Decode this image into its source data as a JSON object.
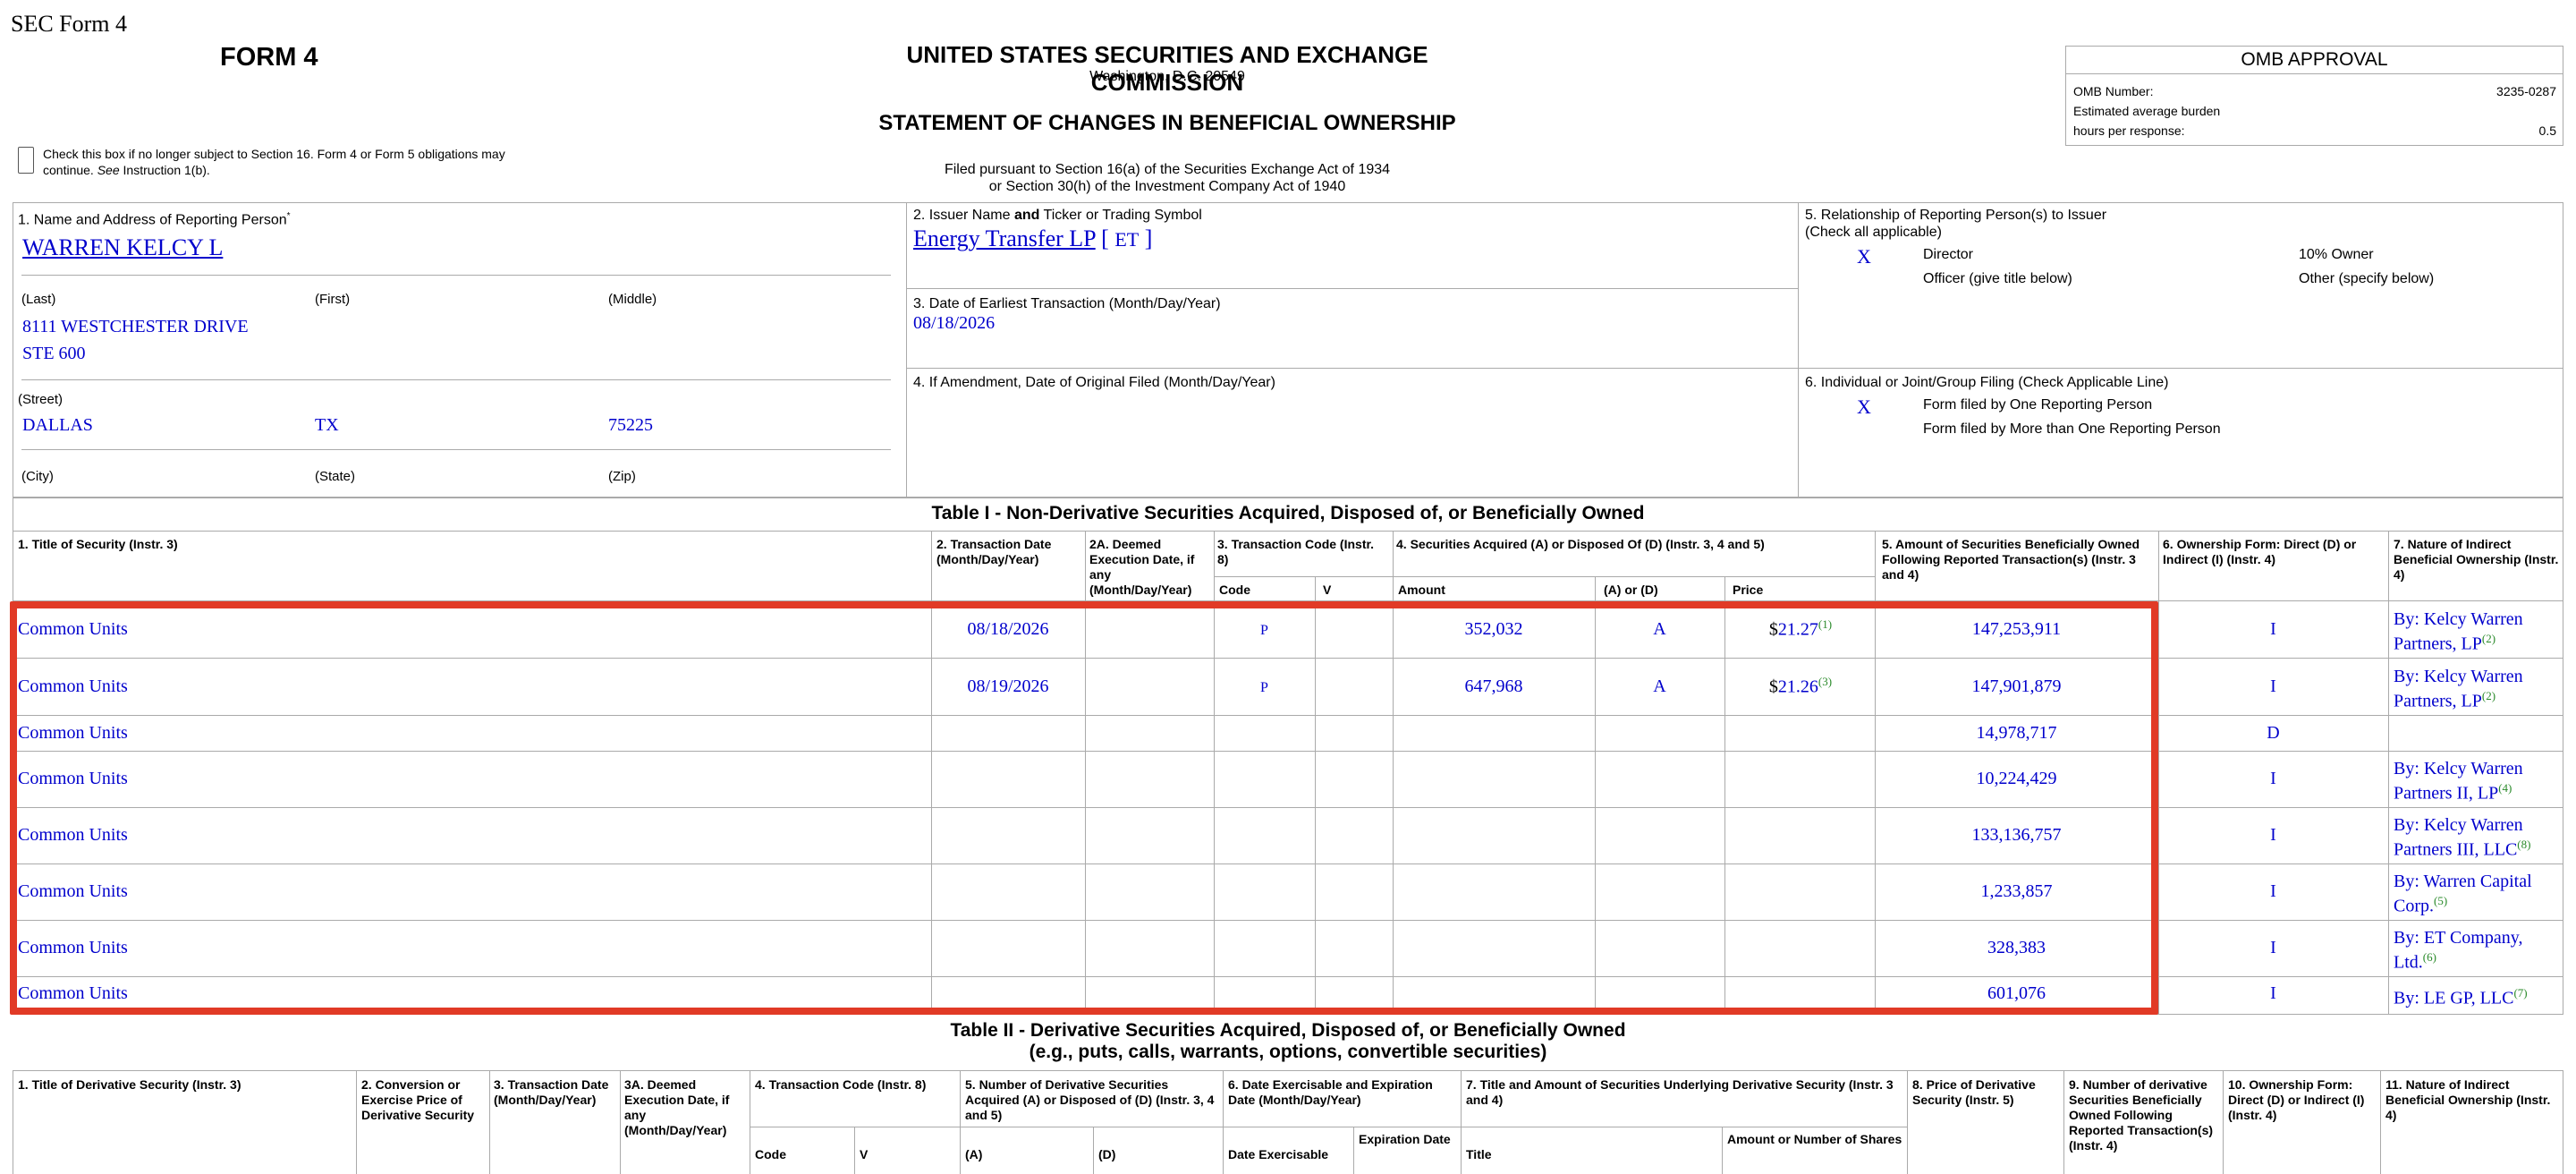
{
  "header": {
    "sec_form_label": "SEC Form 4",
    "form_title": "FORM 4",
    "agency": "UNITED STATES SECURITIES AND EXCHANGE COMMISSION",
    "agency_location": "Washington, D.C. 20549",
    "statement_title": "STATEMENT OF CHANGES IN BENEFICIAL OWNERSHIP",
    "filed_line1": "Filed pursuant to Section 16(a) of the Securities Exchange Act of 1934",
    "filed_line2": "or Section 30(h) of the Investment Company Act of 1940",
    "checkbox_text_a": "Check this box if no longer subject to Section 16. Form 4 or Form 5 obligations may continue.",
    "checkbox_text_see": "See",
    "checkbox_text_b": "Instruction 1(b)."
  },
  "omb": {
    "title": "OMB APPROVAL",
    "number_label": "OMB Number:",
    "number_value": "3235-0287",
    "burden_label": "Estimated average burden",
    "hours_label": "hours per response:",
    "hours_value": "0.5"
  },
  "box1": {
    "label": "1. Name and Address of Reporting Person",
    "asterisk": "*",
    "name": "WARREN KELCY L",
    "last_label": "(Last)",
    "first_label": "(First)",
    "middle_label": "(Middle)",
    "street1": "8111 WESTCHESTER DRIVE",
    "street2": "STE 600",
    "street_label": "(Street)",
    "city": "DALLAS",
    "state": "TX",
    "zip": "75225",
    "city_label": "(City)",
    "state_label": "(State)",
    "zip_label": "(Zip)"
  },
  "box2": {
    "label_a": "2. Issuer Name",
    "label_and": "and",
    "label_b": "Ticker or Trading Symbol",
    "issuer": "Energy Transfer LP",
    "bracket_open": "[",
    "ticker": "ET",
    "bracket_close": "]"
  },
  "box3": {
    "label": "3. Date of Earliest Transaction (Month/Day/Year)",
    "date": "08/18/2026"
  },
  "box4": {
    "label": "4. If Amendment, Date of Original Filed (Month/Day/Year)"
  },
  "box5": {
    "label": "5. Relationship of Reporting Person(s) to Issuer",
    "sub": "(Check all applicable)",
    "mark": "X",
    "director": "Director",
    "ten_pct": "10% Owner",
    "officer": "Officer (give title below)",
    "other": "Other (specify below)"
  },
  "box6": {
    "label": "6. Individual or Joint/Group Filing (Check Applicable Line)",
    "mark": "X",
    "one": "Form filed by One Reporting Person",
    "more": "Form filed by More than One Reporting Person"
  },
  "table1": {
    "title": "Table I - Non-Derivative Securities Acquired, Disposed of, or Beneficially Owned",
    "h1": "1. Title of Security (Instr. 3)",
    "h2": "2. Transaction Date (Month/Day/Year)",
    "h2a": "2A. Deemed Execution Date, if any (Month/Day/Year)",
    "h3": "3. Transaction Code (Instr. 8)",
    "h3_code": "Code",
    "h3_v": "V",
    "h4": "4. Securities Acquired (A) or Disposed Of (D) (Instr. 3, 4 and 5)",
    "h4_amount": "Amount",
    "h4_ad": "(A) or (D)",
    "h4_price": "Price",
    "h5": "5. Amount of Securities Beneficially Owned Following Reported Transaction(s) (Instr. 3 and 4)",
    "h6": "6. Ownership Form: Direct (D) or Indirect (I) (Instr. 4)",
    "h7": "7. Nature of Indirect Beneficial Ownership (Instr. 4)",
    "rows": [
      {
        "title": "Common Units",
        "date": "08/18/2026",
        "code": "P",
        "amount": "352,032",
        "ad": "A",
        "dollar": "$",
        "price": "21.27",
        "price_fn": "(1)",
        "owned": "147,253,911",
        "form": "I",
        "nature1": "By: Kelcy Warren",
        "nature2": "Partners, LP",
        "nature_fn": "(2)"
      },
      {
        "title": "Common Units",
        "date": "08/19/2026",
        "code": "P",
        "amount": "647,968",
        "ad": "A",
        "dollar": "$",
        "price": "21.26",
        "price_fn": "(3)",
        "owned": "147,901,879",
        "form": "I",
        "nature1": "By: Kelcy Warren",
        "nature2": "Partners, LP",
        "nature_fn": "(2)"
      },
      {
        "title": "Common Units",
        "owned": "14,978,717",
        "form": "D"
      },
      {
        "title": "Common Units",
        "owned": "10,224,429",
        "form": "I",
        "nature1": "By: Kelcy Warren",
        "nature2": "Partners II, LP",
        "nature_fn": "(4)"
      },
      {
        "title": "Common Units",
        "owned": "133,136,757",
        "form": "I",
        "nature1": "By: Kelcy Warren",
        "nature2": "Partners III, LLC",
        "nature_fn": "(8)"
      },
      {
        "title": "Common Units",
        "owned": "1,233,857",
        "form": "I",
        "nature1": "By: Warren Capital",
        "nature2": "Corp.",
        "nature_fn": "(5)"
      },
      {
        "title": "Common Units",
        "owned": "328,383",
        "form": "I",
        "nature1": "By: ET Company,",
        "nature2": "Ltd.",
        "nature_fn": "(6)"
      },
      {
        "title": "Common Units",
        "owned": "601,076",
        "form": "I",
        "nature1": "By: LE GP, LLC",
        "nature_fn": "(7)"
      }
    ]
  },
  "table2": {
    "title1": "Table II - Derivative Securities Acquired, Disposed of, or Beneficially Owned",
    "title2": "(e.g., puts, calls, warrants, options, convertible securities)",
    "h1": "1. Title of Derivative Security (Instr. 3)",
    "h2": "2. Conversion or Exercise Price of Derivative Security",
    "h3": "3. Transaction Date (Month/Day/Year)",
    "h3a": "3A. Deemed Execution Date, if any (Month/Day/Year)",
    "h4": "4. Transaction Code (Instr. 8)",
    "h4_code": "Code",
    "h4_v": "V",
    "h5": "5. Number of Derivative Securities Acquired (A) or Disposed of (D) (Instr. 3, 4 and 5)",
    "h5_a": "(A)",
    "h5_d": "(D)",
    "h6": "6. Date Exercisable and Expiration Date (Month/Day/Year)",
    "h6_ex": "Date Exercisable",
    "h6_exp": "Expiration Date",
    "h7": "7. Title and Amount of Securities Underlying Derivative Security (Instr. 3 and 4)",
    "h7_title": "Title",
    "h7_amount": "Amount or Number of Shares",
    "h8": "8. Price of Derivative Security (Instr. 5)",
    "h9": "9. Number of derivative Securities Beneficially Owned Following Reported Transaction(s) (Instr. 4)",
    "h10": "10. Ownership Form: Direct (D) or Indirect (I) (Instr. 4)",
    "h11": "11. Nature of Indirect Beneficial Ownership (Instr. 4)"
  }
}
